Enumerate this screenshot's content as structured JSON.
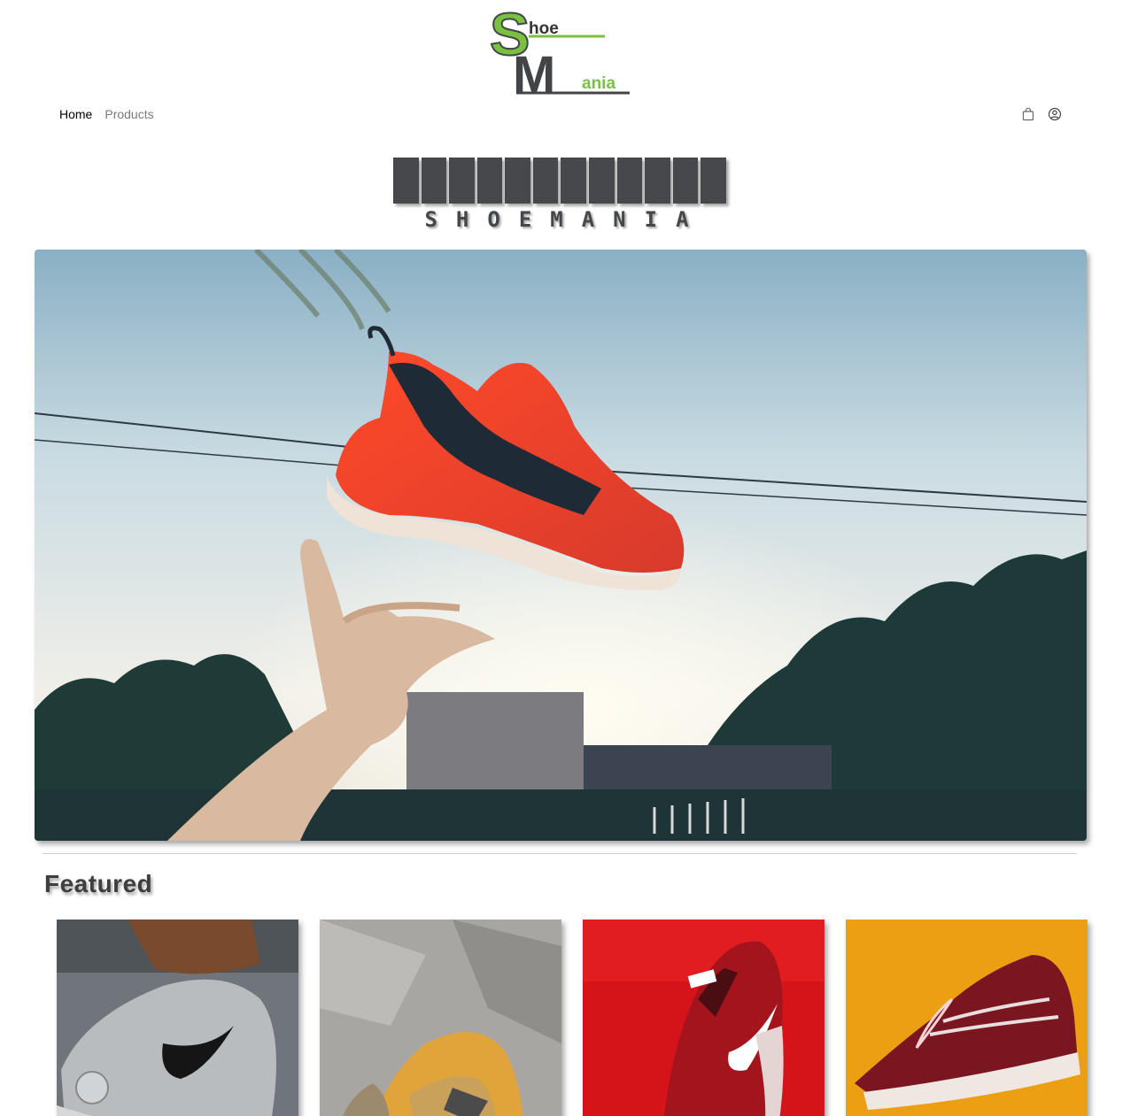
{
  "logo": {
    "line1": "hoe",
    "line2": "ania",
    "initial1": "S",
    "initial2": "M",
    "alt": "ShoeMania logo"
  },
  "nav": {
    "items": [
      {
        "label": "Home",
        "active": true
      },
      {
        "label": "Products",
        "active": false
      }
    ]
  },
  "nav_icons": [
    "shopping-bag-icon",
    "user-circle-icon"
  ],
  "brand": {
    "text": "SHOEMANIA"
  },
  "hero": {
    "alt": "Red sneaker thrown in the air against a sunny sky"
  },
  "featured": {
    "title": "Featured",
    "products": [
      {
        "alt": "Grey Nike sneaker on foot"
      },
      {
        "alt": "Sneaker sole on crumpled paper"
      },
      {
        "alt": "Red Nike running shoe"
      },
      {
        "alt": "Maroon Vans sneaker on yellow"
      }
    ]
  },
  "colors": {
    "accent_green": "#7ac142",
    "logo_gray": "#434447",
    "brand_gray": "#46484c"
  }
}
